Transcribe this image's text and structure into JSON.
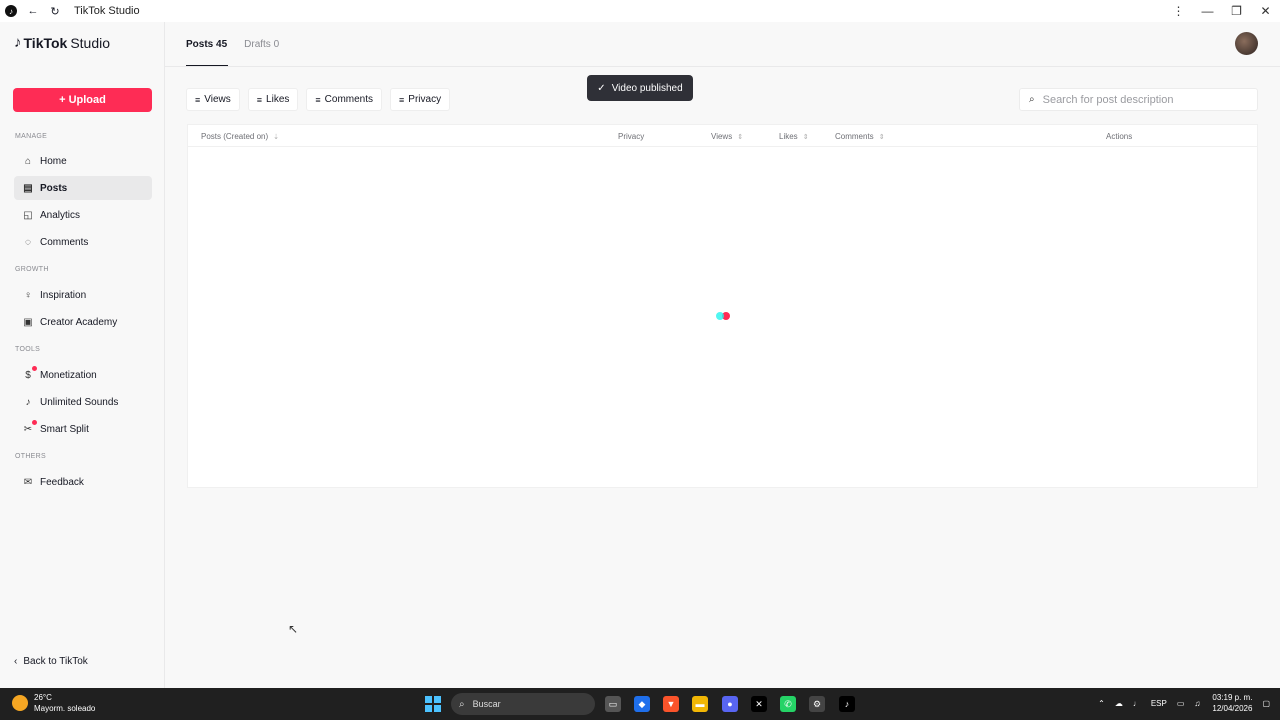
{
  "window": {
    "title": "TikTok Studio",
    "app_icon": "tiktok-icon"
  },
  "sidebar": {
    "brand_main": "TikTok",
    "brand_sub": "Studio",
    "upload_label": "Upload",
    "sections": {
      "manage": "MANAGE",
      "growth": "GROWTH",
      "tools": "TOOLS",
      "others": "OTHERS"
    },
    "items": [
      {
        "label": "Home",
        "icon": "home-icon"
      },
      {
        "label": "Posts",
        "icon": "posts-icon",
        "active": true
      },
      {
        "label": "Analytics",
        "icon": "analytics-icon"
      },
      {
        "label": "Comments",
        "icon": "comment-icon"
      },
      {
        "label": "Inspiration",
        "icon": "lightbulb-icon"
      },
      {
        "label": "Creator Academy",
        "icon": "academy-icon"
      },
      {
        "label": "Monetization",
        "icon": "dollar-icon",
        "badge": true
      },
      {
        "label": "Unlimited Sounds",
        "icon": "music-note-icon"
      },
      {
        "label": "Smart Split",
        "icon": "scissors-icon",
        "badge": true
      },
      {
        "label": "Feedback",
        "icon": "mail-icon"
      }
    ],
    "back_label": "Back to TikTok"
  },
  "header": {
    "tabs": [
      {
        "label": "Posts 45",
        "active": true
      },
      {
        "label": "Drafts 0",
        "active": false
      }
    ]
  },
  "filters": [
    "Views",
    "Likes",
    "Comments",
    "Privacy"
  ],
  "toast": {
    "text": "Video published"
  },
  "search": {
    "placeholder": "Search for post description",
    "value": ""
  },
  "table": {
    "columns": [
      "Posts (Created on)",
      "Privacy",
      "Views",
      "Likes",
      "Comments",
      "Actions"
    ],
    "rows": []
  },
  "taskbar": {
    "weather_temp": "26°C",
    "weather_desc": "Mayorm. soleado",
    "search_label": "Buscar",
    "lang": "ESP",
    "time": "03:19 p. m.",
    "date": "12/04/2026"
  },
  "colors": {
    "accent": "#fe2c55",
    "accent_alt": "#25f4ee",
    "text": "#161823"
  }
}
